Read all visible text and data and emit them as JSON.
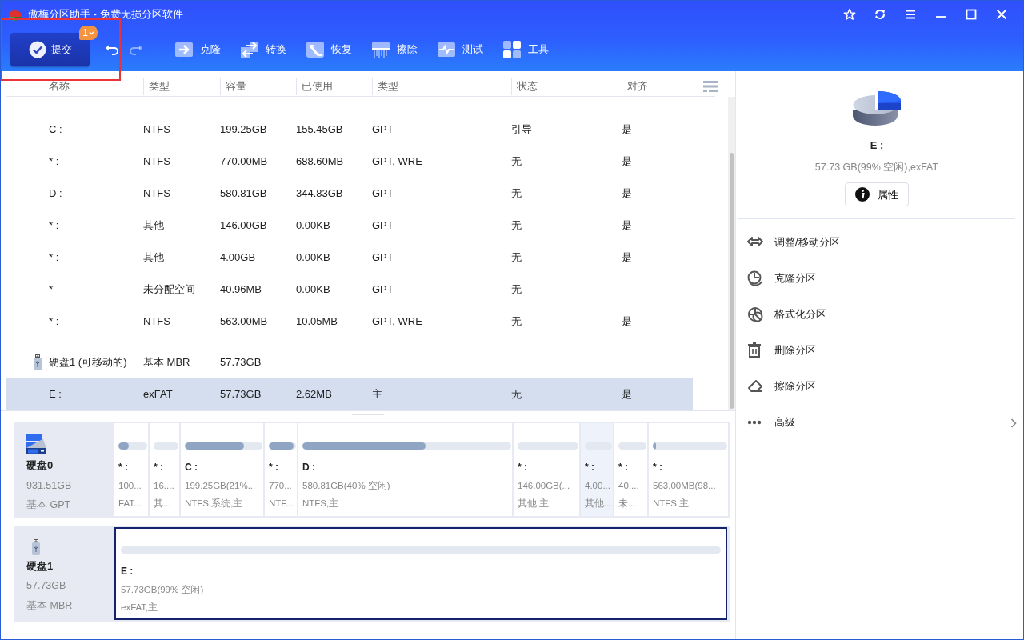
{
  "window": {
    "title": "傲梅分区助手 - 免费无损分区软件"
  },
  "toolbar": {
    "submit": {
      "label": "提交",
      "badge": "1",
      "annotated": true
    },
    "undo": {
      "disabled": false
    },
    "redo": {
      "disabled": true
    },
    "tools": [
      {
        "kind": "clone",
        "label": "克隆"
      },
      {
        "kind": "convert",
        "label": "转换"
      },
      {
        "kind": "recover",
        "label": "恢复"
      },
      {
        "kind": "wipe",
        "label": "擦除"
      },
      {
        "kind": "test",
        "label": "测试"
      },
      {
        "kind": "tools",
        "label": "工具"
      }
    ]
  },
  "table": {
    "columns": [
      "名称",
      "类型",
      "容量",
      "已使用",
      "类型",
      "状态",
      "对齐"
    ],
    "rows": [
      {
        "kind": "partition",
        "selected": false,
        "cells": [
          "C :",
          "NTFS",
          "199.25GB",
          "155.45GB",
          "GPT",
          "引导",
          "是"
        ]
      },
      {
        "kind": "partition",
        "selected": false,
        "cells": [
          "* :",
          "NTFS",
          "770.00MB",
          "688.60MB",
          "GPT, WRE",
          "无",
          "是"
        ]
      },
      {
        "kind": "partition",
        "selected": false,
        "cells": [
          "D :",
          "NTFS",
          "580.81GB",
          "344.83GB",
          "GPT",
          "无",
          "是"
        ]
      },
      {
        "kind": "partition",
        "selected": false,
        "cells": [
          "* :",
          "其他",
          "146.00GB",
          "0.00KB",
          "GPT",
          "无",
          "是"
        ]
      },
      {
        "kind": "partition",
        "selected": false,
        "cells": [
          "* :",
          "其他",
          "4.00GB",
          "0.00KB",
          "GPT",
          "无",
          "是"
        ]
      },
      {
        "kind": "partition",
        "selected": false,
        "cells": [
          "*",
          "未分配空间",
          "40.96MB",
          "0.00KB",
          "GPT",
          "无"
        ]
      },
      {
        "kind": "partition",
        "selected": false,
        "cells": [
          "* :",
          "NTFS",
          "563.00MB",
          "10.05MB",
          "GPT, WRE",
          "无",
          "是"
        ]
      },
      {
        "kind": "disk",
        "selected": false,
        "cells": [
          "硬盘1 (可移动的)",
          "基本 MBR",
          "57.73GB"
        ]
      },
      {
        "kind": "partition",
        "selected": true,
        "cells": [
          "E :",
          "exFAT",
          "57.73GB",
          "2.62MB",
          "主",
          "无",
          "是"
        ]
      }
    ]
  },
  "disk_map": [
    {
      "kind": "ssd",
      "name": "硬盘0",
      "size": "931.51GB",
      "style": "基本 GPT",
      "partitions": [
        {
          "name": "* :",
          "size": "100...",
          "info": "FAT...",
          "level": 0.35,
          "selected": false,
          "hovered": false
        },
        {
          "name": "* :",
          "size": "16....",
          "info": "其...",
          "selected": false,
          "hovered": false
        },
        {
          "name": "C :",
          "size": "199.25GB(21%...",
          "info": "NTFS,系统,主",
          "level": 0.76,
          "selected": false,
          "hovered": false
        },
        {
          "name": "* :",
          "size": "770...",
          "info": "NTF...",
          "level": 0.9,
          "selected": false,
          "hovered": false
        },
        {
          "name": "D :",
          "size": "580.81GB(40% 空闲)",
          "info": "NTFS,主",
          "level": 0.59,
          "selected": false,
          "hovered": false
        },
        {
          "name": "* :",
          "size": "146.00GB(...",
          "info": "其他,主",
          "selected": false,
          "hovered": false
        },
        {
          "name": "* :",
          "size": "4.00...",
          "info": "其他...",
          "selected": false,
          "hovered": true
        },
        {
          "name": "* :",
          "size": "40....",
          "info": "未...",
          "selected": false,
          "hovered": false
        },
        {
          "name": "* :",
          "size": "563.00MB(98...",
          "info": "NTFS,主",
          "level": 0.04,
          "selected": false,
          "hovered": false
        }
      ]
    },
    {
      "kind": "usb",
      "name": "硬盘1",
      "size": "57.73GB",
      "style": "基本 MBR",
      "partitions": [
        {
          "name": "E :",
          "size": "57.73GB(99% 空闲)",
          "info": "exFAT,主",
          "selected": true,
          "hovered": false
        }
      ]
    }
  ],
  "details": {
    "name": "E :",
    "summary": "57.73 GB(99% 空闲),exFAT",
    "properties_button": "属性",
    "actions": [
      {
        "kind": "resize",
        "label": "调整/移动分区"
      },
      {
        "kind": "clone",
        "label": "克隆分区"
      },
      {
        "kind": "format",
        "label": "格式化分区"
      },
      {
        "kind": "delete",
        "label": "删除分区"
      },
      {
        "kind": "wipe",
        "label": "擦除分区"
      },
      {
        "kind": "more",
        "label": "高级",
        "submenu": true
      }
    ]
  }
}
